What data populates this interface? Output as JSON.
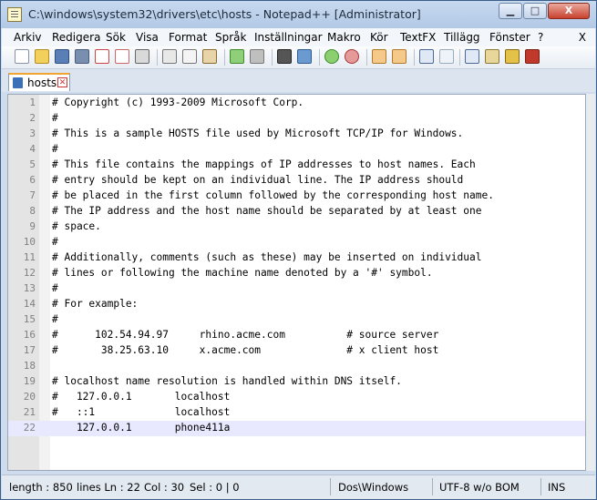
{
  "window": {
    "title": "C:\\windows\\system32\\drivers\\etc\\hosts - Notepad++ [Administrator]",
    "minimize": "▁",
    "maximize": "□",
    "close": "X"
  },
  "menu": {
    "items": [
      "Arkiv",
      "Redigera",
      "Sök",
      "Visa",
      "Format",
      "Språk",
      "Inställningar",
      "Makro",
      "Kör",
      "TextFX",
      "Tillägg",
      "Fönster",
      "?"
    ],
    "close": "X"
  },
  "toolbar": {
    "icons": [
      "new-file-icon",
      "open-file-icon",
      "save-icon",
      "save-all-icon",
      "close-icon",
      "close-all-icon",
      "print-icon",
      "cut-icon",
      "copy-icon",
      "paste-icon",
      "undo-icon",
      "redo-icon",
      "find-icon",
      "replace-icon",
      "zoom-in-icon",
      "zoom-out-icon",
      "sync-vertical-icon",
      "sync-horizontal-icon",
      "word-wrap-icon",
      "show-all-chars-icon",
      "indent-guide-icon",
      "doc-map-icon",
      "macro-record-icon",
      "macro-play-icon"
    ]
  },
  "tab": {
    "label": "hosts",
    "close": "✕",
    "accent": "#f0a431"
  },
  "editor": {
    "current_line": 22,
    "lines": [
      {
        "n": "1",
        "text": "# Copyright (c) 1993-2009 Microsoft Corp."
      },
      {
        "n": "2",
        "text": "#"
      },
      {
        "n": "3",
        "text": "# This is a sample HOSTS file used by Microsoft TCP/IP for Windows."
      },
      {
        "n": "4",
        "text": "#"
      },
      {
        "n": "5",
        "text": "# This file contains the mappings of IP addresses to host names. Each"
      },
      {
        "n": "6",
        "text": "# entry should be kept on an individual line. The IP address should"
      },
      {
        "n": "7",
        "text": "# be placed in the first column followed by the corresponding host name."
      },
      {
        "n": "8",
        "text": "# The IP address and the host name should be separated by at least one"
      },
      {
        "n": "9",
        "text": "# space."
      },
      {
        "n": "10",
        "text": "#"
      },
      {
        "n": "11",
        "text": "# Additionally, comments (such as these) may be inserted on individual"
      },
      {
        "n": "12",
        "text": "# lines or following the machine name denoted by a '#' symbol."
      },
      {
        "n": "13",
        "text": "#"
      },
      {
        "n": "14",
        "text": "# For example:"
      },
      {
        "n": "15",
        "text": "#"
      },
      {
        "n": "16",
        "text": "#      102.54.94.97     rhino.acme.com          # source server"
      },
      {
        "n": "17",
        "text": "#       38.25.63.10     x.acme.com              # x client host"
      },
      {
        "n": "18",
        "text": ""
      },
      {
        "n": "19",
        "text": "# localhost name resolution is handled within DNS itself."
      },
      {
        "n": "20",
        "text": "#   127.0.0.1       localhost"
      },
      {
        "n": "21",
        "text": "#   ::1             localhost"
      },
      {
        "n": "22",
        "text": "    127.0.0.1       phone411a"
      }
    ]
  },
  "status": {
    "length": "length : 850",
    "position": "lines Ln : 22",
    "col": "Col : 30",
    "sel": "Sel : 0 | 0",
    "eol": "Dos\\Windows",
    "encoding": "UTF-8 w/o BOM",
    "mode": "INS"
  }
}
